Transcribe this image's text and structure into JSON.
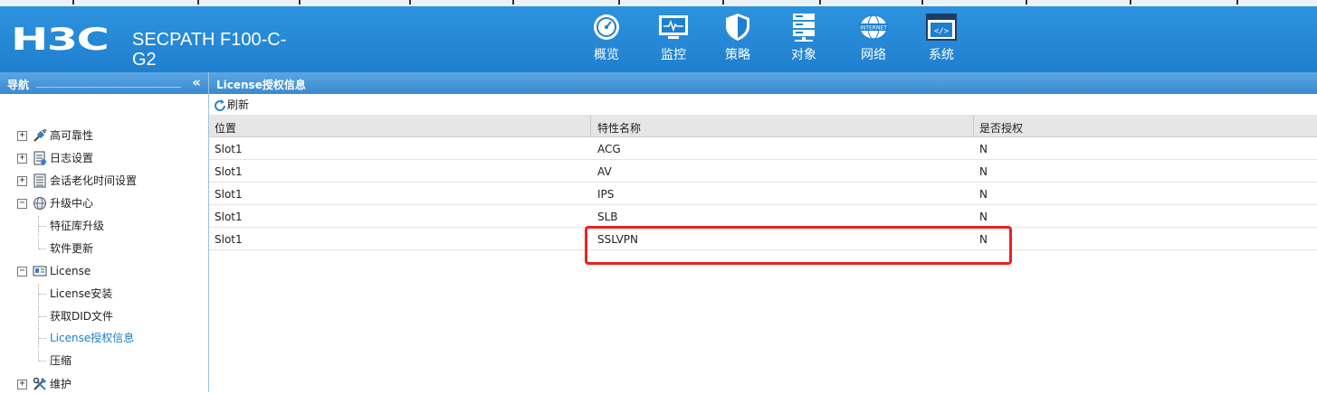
{
  "header": {
    "logo": "H3C",
    "product": "SECPATH F100-C-G2",
    "nav": [
      {
        "label": "概览",
        "icon": "gauge-icon"
      },
      {
        "label": "监控",
        "icon": "monitor-icon"
      },
      {
        "label": "策略",
        "icon": "shield-icon"
      },
      {
        "label": "对象",
        "icon": "server-stack-icon"
      },
      {
        "label": "网络",
        "icon": "internet-globe-icon",
        "icon_text": "INTERNET"
      },
      {
        "label": "系统",
        "icon": "code-window-icon",
        "icon_text": "</>",
        "active": true
      }
    ]
  },
  "sidebar": {
    "title": "导航",
    "collapse_glyph": "«",
    "items": [
      {
        "label": "高可靠性",
        "expander": "+",
        "icon": "plug-icon"
      },
      {
        "label": "日志设置",
        "expander": "+",
        "icon": "log-document-icon"
      },
      {
        "label": "会话老化时间设置",
        "expander": "+",
        "icon": "notepad-icon"
      },
      {
        "label": "升级中心",
        "expander": "−",
        "icon": "upgrade-globe-icon"
      },
      {
        "label": "特征库升级",
        "child": true
      },
      {
        "label": "软件更新",
        "child": true
      },
      {
        "label": "License",
        "expander": "−",
        "icon": "id-card-icon"
      },
      {
        "label": "License安装",
        "child": true
      },
      {
        "label": "获取DID文件",
        "child": true
      },
      {
        "label": "License授权信息",
        "child": true,
        "selected": true
      },
      {
        "label": "压缩",
        "child": true
      },
      {
        "label": "维护",
        "expander": "+",
        "icon": "tools-icon"
      }
    ]
  },
  "main": {
    "title": "License授权信息",
    "refresh_label": "刷新",
    "columns": [
      "位置",
      "特性名称",
      "是否授权"
    ],
    "rows": [
      [
        "Slot1",
        "ACG",
        "N"
      ],
      [
        "Slot1",
        "AV",
        "N"
      ],
      [
        "Slot1",
        "IPS",
        "N"
      ],
      [
        "Slot1",
        "SLB",
        "N"
      ],
      [
        "Slot1",
        "SSLVPN",
        "N"
      ]
    ]
  },
  "colors": {
    "header_blue": "#2389d8",
    "panel_head_blue": "#4a98dc",
    "highlight_red": "#e8231e",
    "selected_link": "#1e7ec8"
  }
}
